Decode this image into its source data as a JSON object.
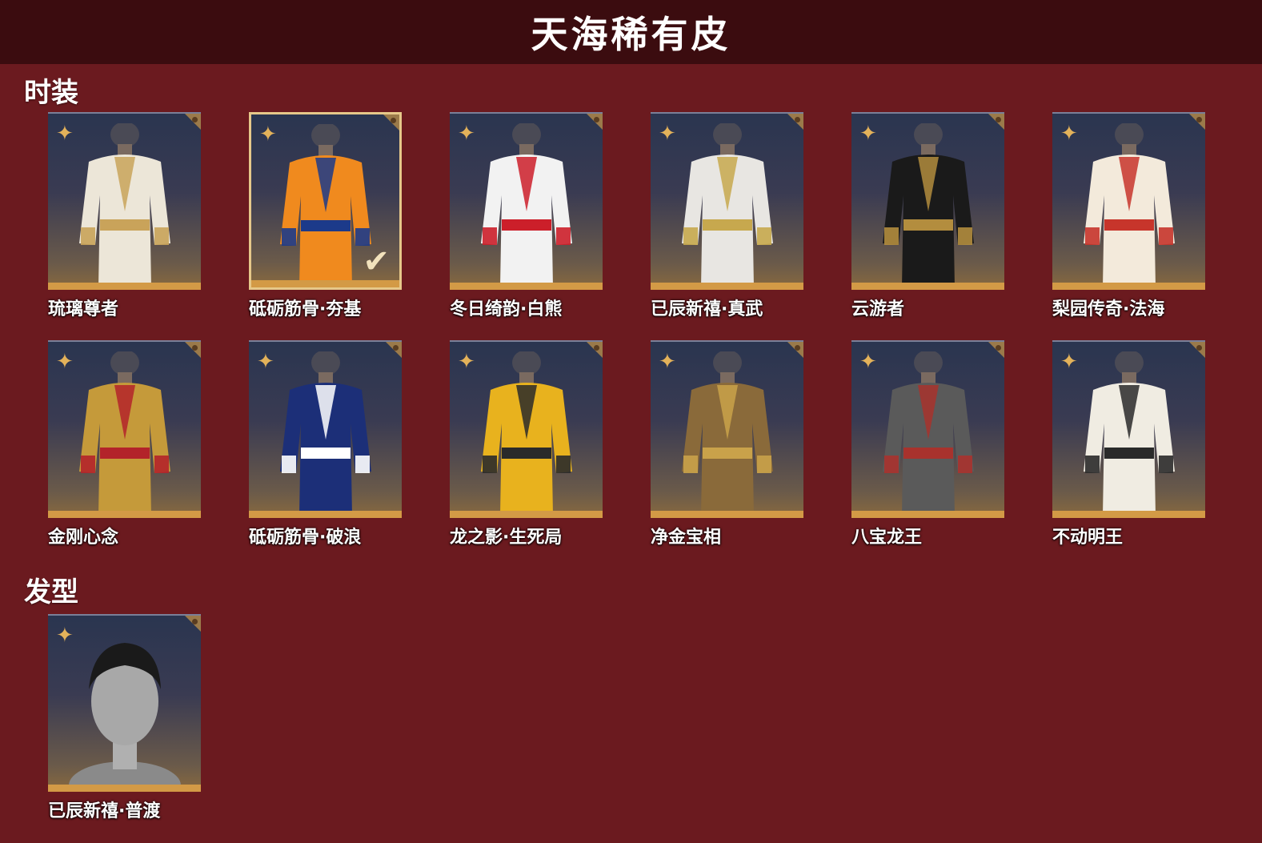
{
  "header": {
    "title": "天海稀有皮"
  },
  "sections": {
    "outfits": {
      "title": "时装",
      "items": [
        {
          "name": "琉璃尊者",
          "colors": [
            "#ece6d8",
            "#c9a35a"
          ],
          "selected": false,
          "icon": "white-gold-robe"
        },
        {
          "name": "砥砺筋骨·夯基",
          "colors": [
            "#f08a1e",
            "#1c3a8a"
          ],
          "selected": true,
          "icon": "orange-track-jacket"
        },
        {
          "name": "冬日绮韵·白熊",
          "colors": [
            "#f2f2f2",
            "#cc1f2a"
          ],
          "selected": false,
          "icon": "white-bear-red-scarf"
        },
        {
          "name": "已辰新禧·真武",
          "colors": [
            "#e8e6e2",
            "#c7a84e"
          ],
          "selected": false,
          "icon": "white-armored-robe"
        },
        {
          "name": "云游者",
          "colors": [
            "#1a1a1a",
            "#b38d3e"
          ],
          "selected": false,
          "icon": "black-vest"
        },
        {
          "name": "梨园传奇·法海",
          "colors": [
            "#f3eadb",
            "#c7352b"
          ],
          "selected": false,
          "icon": "white-red-monk-robe"
        },
        {
          "name": "金刚心念",
          "colors": [
            "#c59a3a",
            "#b3232a"
          ],
          "selected": false,
          "icon": "golden-armor"
        },
        {
          "name": "砥砺筋骨·破浪",
          "colors": [
            "#1c2f78",
            "#ffffff"
          ],
          "selected": false,
          "icon": "blue-white-track-jacket"
        },
        {
          "name": "龙之影·生死局",
          "colors": [
            "#e8b21e",
            "#2a2a2a"
          ],
          "selected": false,
          "icon": "yellow-jumpsuit"
        },
        {
          "name": "净金宝相",
          "colors": [
            "#8a6a3a",
            "#c9a24a"
          ],
          "selected": false,
          "icon": "bronze-vest"
        },
        {
          "name": "八宝龙王",
          "colors": [
            "#5a5a5a",
            "#a8322d"
          ],
          "selected": false,
          "icon": "dragon-king-armor"
        },
        {
          "name": "不动明王",
          "colors": [
            "#f0ece2",
            "#2a2a2a"
          ],
          "selected": false,
          "icon": "white-black-armor"
        }
      ]
    },
    "hairstyles": {
      "title": "发型",
      "items": [
        {
          "name": "已辰新禧·普渡",
          "colors": [
            "#1a1a1a",
            "#a8a8a8"
          ],
          "selected": false,
          "icon": "short-black-hair"
        }
      ]
    }
  },
  "icons": {
    "rarity": "four-point-star-icon",
    "corner": "corner-badge-icon",
    "check": "check-icon"
  },
  "glyphs": {
    "rarity": "✦",
    "check": "✔"
  },
  "colors": {
    "background": "#6b1a1f",
    "header_bg": "#3b0c0f",
    "accent_gold": "#d39a46",
    "selected_border": "#e6c88a"
  }
}
